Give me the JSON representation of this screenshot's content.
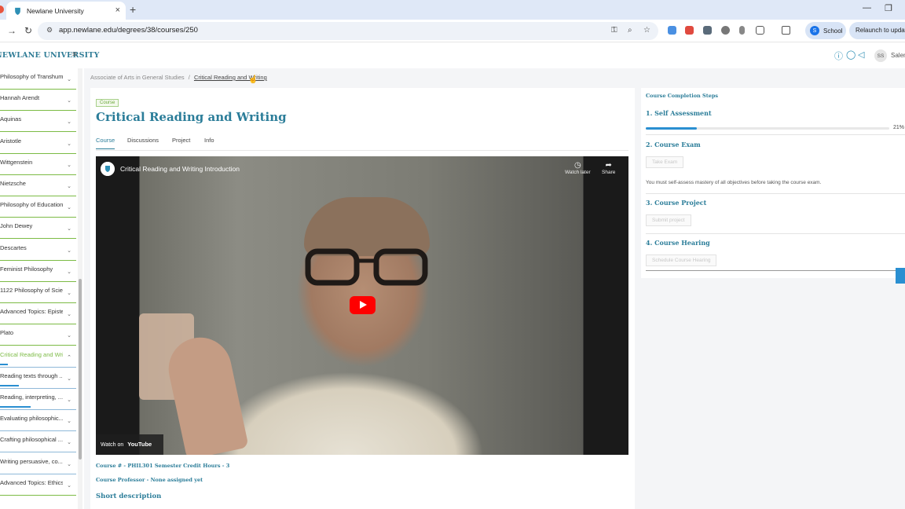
{
  "browser": {
    "tab_title": "Newlane University",
    "new_tab": "+",
    "tab_close": "×",
    "url": "app.newlane.edu/degrees/38/courses/250",
    "profile_initial": "S",
    "profile_label": "School",
    "relaunch_label": "Relaunch to update",
    "minimize": "—",
    "restore": "❐"
  },
  "header": {
    "logo": "NEWLANE UNIVERSITY",
    "menu_icon": "≡",
    "avatar_initials": "SS",
    "user_name": "Salem"
  },
  "sidebar": {
    "items": [
      {
        "label": "Philosophy of Transhum...",
        "chevron": "⌄"
      },
      {
        "label": "Hannah Arendt",
        "chevron": "⌄"
      },
      {
        "label": "Aquinas",
        "chevron": "⌄"
      },
      {
        "label": "Aristotle",
        "chevron": "⌄"
      },
      {
        "label": "Wittgenstein",
        "chevron": "⌄"
      },
      {
        "label": "Nietzsche",
        "chevron": "⌄"
      },
      {
        "label": "Philosophy of Education",
        "chevron": "⌄"
      },
      {
        "label": "John Dewey",
        "chevron": "⌄"
      },
      {
        "label": "Descartes",
        "chevron": "⌄"
      },
      {
        "label": "Feminist Philosophy",
        "chevron": "⌄"
      },
      {
        "label": "1122 Philosophy of Scie...",
        "chevron": "⌄"
      },
      {
        "label": "Advanced Topics: Episte...",
        "chevron": "⌄"
      },
      {
        "label": "Plato",
        "chevron": "⌄"
      },
      {
        "label": "Critical Reading and Wri...",
        "chevron": "⌃"
      },
      {
        "label": "Reading texts through ...",
        "chevron": "⌄"
      },
      {
        "label": "Reading, interpreting, ...",
        "chevron": "⌄"
      },
      {
        "label": "Evaluating philosophic...",
        "chevron": "⌄"
      },
      {
        "label": "Crafting philosophical ...",
        "chevron": "⌄"
      },
      {
        "label": "Writing persuasive, co...",
        "chevron": "⌄"
      },
      {
        "label": "Advanced Topics: Ethics",
        "chevron": "⌄"
      }
    ],
    "progress": [
      0.1,
      0.25,
      0.4,
      0,
      0,
      0
    ]
  },
  "breadcrumb": {
    "parent": "Associate of Arts in General Studies",
    "sep": "/",
    "current": "Critical Reading and Writing"
  },
  "course": {
    "chip": "Course",
    "title": "Critical Reading and Writing",
    "tabs": [
      "Course",
      "Discussions",
      "Project",
      "Info"
    ],
    "video": {
      "title": "Critical Reading and Writing Introduction",
      "watch_later": "Watch later",
      "share": "Share",
      "watch_on": "Watch on",
      "youtube": "YouTube"
    },
    "meta_line1": "Course # - PHIL301  Semester Credit Hours - 3",
    "meta_line2": "Course Professor - None assigned yet",
    "short_desc": "Short description"
  },
  "steps": {
    "heading": "Course Completion Steps",
    "self_assessment": "1. Self Assessment",
    "progress_label": "21%",
    "progress": 0.21,
    "exam": "2. Course Exam",
    "exam_button": "Take Exam",
    "exam_note": "You must self-assess mastery of all objectives before taking the course exam.",
    "project": "3. Course Project",
    "project_button": "Submit project",
    "hearing": "4. Course Hearing",
    "hearing_button": "Schedule Course Hearing"
  }
}
